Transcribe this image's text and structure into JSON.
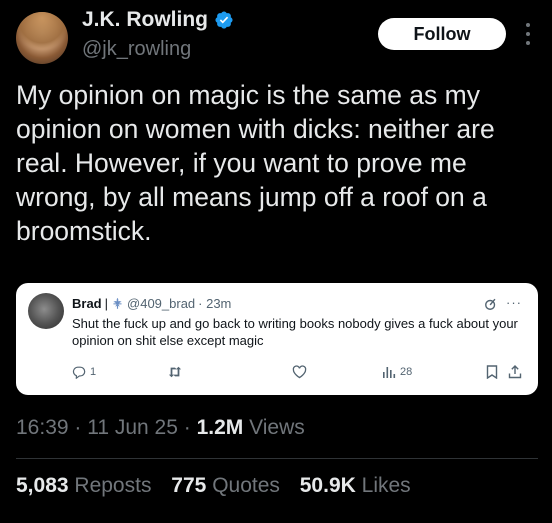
{
  "author": {
    "name": "J.K. Rowling",
    "handle": "@jk_rowling",
    "verified_icon": "verified-badge-icon"
  },
  "follow_label": "Follow",
  "tweet_text": "My opinion on magic is the same as my opinion on women with dicks: neither are real. However, if you want to prove me wrong, by all means jump off a roof on a broomstick.",
  "quoted": {
    "name": "Brad",
    "separator": "|",
    "handle": "@409_brad",
    "time": "· 23m",
    "text": "Shut the fuck up and go back to writing books nobody gives a fuck about your opinion on shit else except magic",
    "replies": "1",
    "views": "28"
  },
  "meta": {
    "time": "16:39",
    "date": "11 Jun 25",
    "views_count": "1.2M",
    "views_label": "Views"
  },
  "stats": {
    "reposts_count": "5,083",
    "reposts_label": "Reposts",
    "quotes_count": "775",
    "quotes_label": "Quotes",
    "likes_count": "50.9K",
    "likes_label": "Likes"
  },
  "colors": {
    "background": "#000000",
    "text_primary": "#e7e9ea",
    "text_secondary": "#71767b",
    "verified_blue": "#1d9bf0"
  }
}
